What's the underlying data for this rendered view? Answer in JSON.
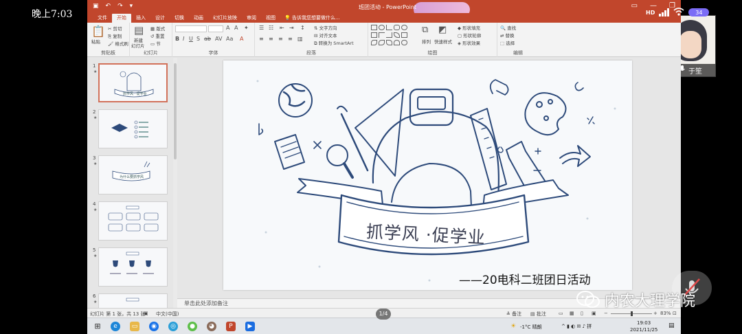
{
  "phone": {
    "clock": "晚上7:03",
    "network": "HD",
    "battery": "34",
    "camera_name": "于笙"
  },
  "window": {
    "title": "班团活动 - PowerPoint"
  },
  "tabs": [
    {
      "label": "文件"
    },
    {
      "label": "开始"
    },
    {
      "label": "插入"
    },
    {
      "label": "设计"
    },
    {
      "label": "切换"
    },
    {
      "label": "动画"
    },
    {
      "label": "幻灯片放映"
    },
    {
      "label": "审阅"
    },
    {
      "label": "视图"
    }
  ],
  "tell_me": "告诉我您想要做什么...",
  "ribbon": {
    "clipboard": {
      "label": "剪贴板",
      "paste": "粘贴",
      "cut": "剪切",
      "copy": "复制",
      "format_painter": "格式刷"
    },
    "slides": {
      "label": "幻灯片",
      "new_slide": "新建",
      "new_slide2": "幻灯片",
      "layout": "版式",
      "reset": "重置",
      "section": "节"
    },
    "font": {
      "label": "字体"
    },
    "paragraph": {
      "label": "段落",
      "text_direction": "文字方向",
      "align_text": "对齐文本",
      "smartart": "转换为 SmartArt"
    },
    "drawing": {
      "label": "绘图",
      "arrange": "排列",
      "quick_styles": "快速样式",
      "fill": "形状填充",
      "outline": "形状轮廓",
      "effects": "形状效果"
    },
    "editing": {
      "label": "编辑",
      "find": "查找",
      "replace": "替换",
      "select": "选择"
    }
  },
  "thumbnails": [
    {
      "num": "1",
      "star": "★",
      "text": "抓学风 · 促学业"
    },
    {
      "num": "2",
      "star": "★",
      "text": ""
    },
    {
      "num": "3",
      "star": "★",
      "text": "为什么要抓学风"
    },
    {
      "num": "4",
      "star": "★",
      "text": ""
    },
    {
      "num": "5",
      "star": "★",
      "text": ""
    },
    {
      "num": "6",
      "star": "★",
      "text": ""
    }
  ],
  "slide": {
    "title": "抓学风 ·促学业",
    "subtitle": "——20电科二班团日活动"
  },
  "notes_placeholder": "单击此处添加备注",
  "statusbar": {
    "slide_info": "幻灯片 第 1 张，共 13 张",
    "language": "中文(中国)",
    "notes_btn": "备注",
    "comments_btn": "批注",
    "zoom": "83%",
    "page_pill": "1/4"
  },
  "taskbar": {
    "weather": "-1°C 晴朗",
    "time": "19:03",
    "date": "2021/11/25"
  },
  "watermark": "内农大理学院",
  "colors": {
    "accent": "#c1462c",
    "slide_ink": "#2d4a7a"
  }
}
